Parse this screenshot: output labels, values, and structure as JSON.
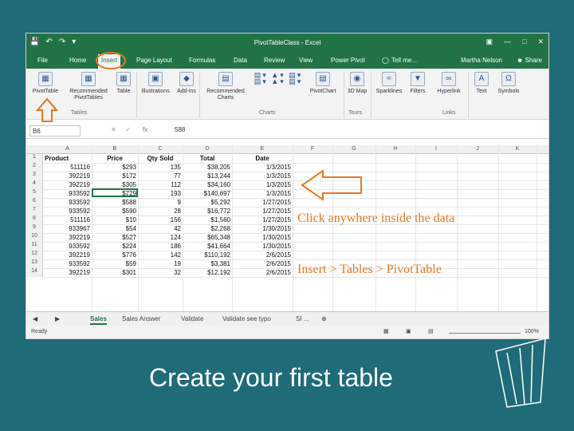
{
  "titlebar": {
    "title": "PivotTableClass - Excel",
    "qa_icons": [
      "save-icon",
      "undo-icon",
      "redo-icon",
      "customize-icon"
    ]
  },
  "tabs": {
    "items": [
      "File",
      "Home",
      "Insert",
      "Page Layout",
      "Formulas",
      "Data",
      "Review",
      "View",
      "Power Pivot"
    ],
    "active": "Insert",
    "tell_me": "Tell me...",
    "user": "Martha Nelson",
    "share": "Share"
  },
  "ribbon": {
    "buttons": {
      "pivottable": "PivotTable",
      "recommended": "Recommended PivotTables",
      "table": "Table",
      "illustrations": "Illustrations",
      "addins": "Add-ins",
      "rec_charts": "Recommended Charts",
      "pivotchart": "PivotChart",
      "map3d": "3D Map",
      "sparklines": "Sparklines",
      "filters": "Filters",
      "hyperlink": "Hyperlink",
      "text": "Text",
      "symbols": "Symbols"
    },
    "groups": {
      "tables": "Tables",
      "charts": "Charts",
      "tours": "Tours",
      "links": "Links"
    }
  },
  "formula_bar": {
    "name_box": "B6",
    "fx": "fx",
    "value": "588"
  },
  "grid": {
    "columns": [
      "A",
      "B",
      "C",
      "D",
      "E",
      "F",
      "G",
      "H",
      "I",
      "J",
      "K"
    ],
    "headers": [
      "Product",
      "Price",
      "Qty Sold",
      "Total",
      "Date"
    ],
    "rows": [
      [
        "511116",
        "$293",
        "135",
        "$38,205",
        "1/3/2015"
      ],
      [
        "392219",
        "$172",
        "77",
        "$13,244",
        "1/3/2015"
      ],
      [
        "392219",
        "$305",
        "112",
        "$34,160",
        "1/3/2015"
      ],
      [
        "933592",
        "$729",
        "193",
        "$140,697",
        "1/3/2015"
      ],
      [
        "933592",
        "$588",
        "9",
        "$5,292",
        "1/27/2015"
      ],
      [
        "933592",
        "$590",
        "28",
        "$16,772",
        "1/27/2015"
      ],
      [
        "511116",
        "$10",
        "156",
        "$1,560",
        "1/27/2015"
      ],
      [
        "933967",
        "$54",
        "42",
        "$2,268",
        "1/30/2015"
      ],
      [
        "392219",
        "$527",
        "124",
        "$65,348",
        "1/30/2015"
      ],
      [
        "933592",
        "$224",
        "186",
        "$41,664",
        "1/30/2015"
      ],
      [
        "392219",
        "$776",
        "142",
        "$110,192",
        "2/6/2015"
      ],
      [
        "933592",
        "$59",
        "19",
        "$3,381",
        "2/6/2015"
      ],
      [
        "392219",
        "$301",
        "32",
        "$12,192",
        "2/6/2015"
      ]
    ]
  },
  "sheets": {
    "items": [
      "Sales",
      "Sales Answer",
      "Validate",
      "Validate see typo",
      "SI ..."
    ],
    "active": "Sales"
  },
  "status": {
    "ready": "Ready",
    "zoom": "100%"
  },
  "annotations": {
    "click_note": "Click anywhere inside the data",
    "path_note": "Insert > Tables > PivotTable",
    "accent_color": "#e87722"
  },
  "caption": "Create your first table"
}
